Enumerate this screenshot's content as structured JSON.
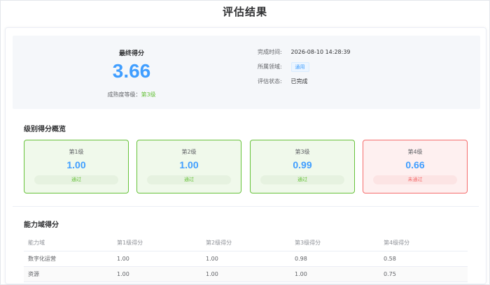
{
  "page_title": "评估结果",
  "summary": {
    "final_score_label": "最终得分",
    "final_score": "3.66",
    "maturity_label": "成熟度等级：",
    "maturity_level": "第3级",
    "completed_label": "完成时间:",
    "completed_value": "2026-08-10 14:28:39",
    "domain_label": "所属领域:",
    "domain_value": "通用",
    "status_label": "评估状态:",
    "status_value": "已完成"
  },
  "level_overview": {
    "title": "级别得分概览",
    "levels": [
      {
        "name": "第1级",
        "score": "1.00",
        "status": "通过"
      },
      {
        "name": "第2级",
        "score": "1.00",
        "status": "通过"
      },
      {
        "name": "第3级",
        "score": "0.99",
        "status": "通过"
      },
      {
        "name": "第4级",
        "score": "0.66",
        "status": "未通过"
      }
    ]
  },
  "domain_scores": {
    "title": "能力域得分",
    "columns": [
      "能力域",
      "第1级得分",
      "第2级得分",
      "第3级得分",
      "第4级得分"
    ],
    "rows": [
      [
        "数字化运营",
        "1.00",
        "1.00",
        "0.98",
        "0.58"
      ],
      [
        "资源",
        "1.00",
        "1.00",
        "1.00",
        "0.75"
      ]
    ]
  },
  "colors": {
    "accent": "#409eff",
    "pass": "#67c23a",
    "fail": "#f56c6c"
  }
}
